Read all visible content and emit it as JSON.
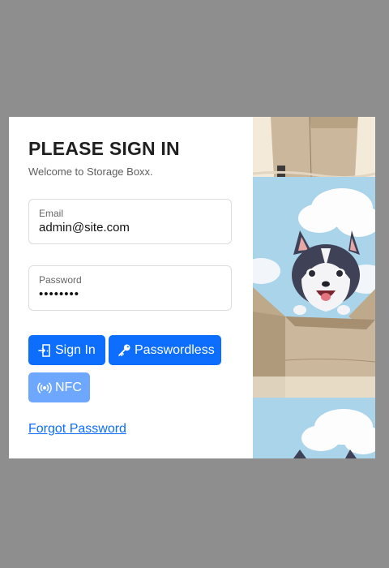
{
  "header": {
    "title": "PLEASE SIGN IN",
    "subtitle": "Welcome to Storage Boxx."
  },
  "form": {
    "email_label": "Email",
    "email_value": "admin@site.com",
    "password_label": "Password",
    "password_value": "••••••••"
  },
  "buttons": {
    "signin_label": "Sign In",
    "signin_icon": "door-enter-icon",
    "passwordless_label": "Passwordless",
    "passwordless_icon": "key-icon",
    "nfc_label": "NFC",
    "nfc_icon": "broadcast-icon"
  },
  "links": {
    "forgot_password": "Forgot Password"
  },
  "colors": {
    "primary": "#0d6efd",
    "primary_disabled": "#6ea8fe",
    "overlay": "#8e8e8e",
    "sky": "#a9d4ea",
    "box": "#cbb79c"
  }
}
